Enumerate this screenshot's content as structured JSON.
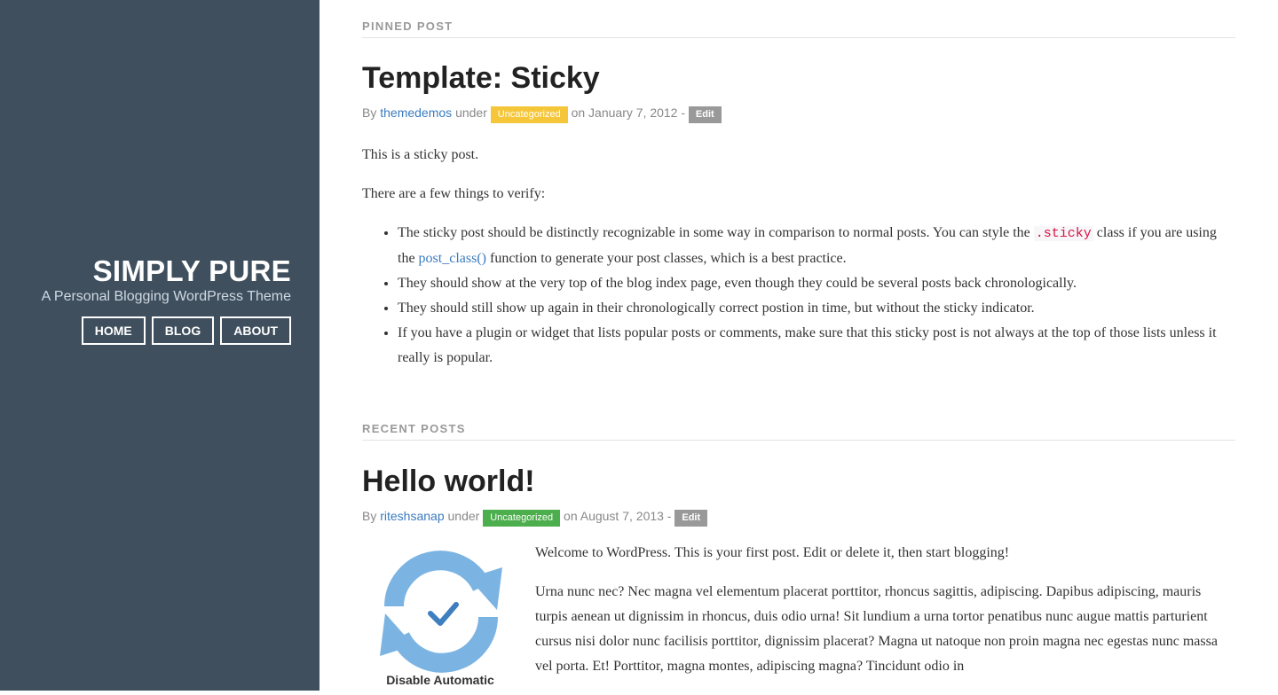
{
  "site": {
    "title": "SIMPLY PURE",
    "description": "A Personal Blogging WordPress Theme"
  },
  "nav": {
    "items": [
      {
        "label": "HOME"
      },
      {
        "label": "BLOG"
      },
      {
        "label": "ABOUT"
      }
    ]
  },
  "pinned": {
    "section_label": "PINNED POST",
    "title": "Template: Sticky",
    "meta": {
      "by": "By",
      "author": "themedemos",
      "under": "under",
      "category": "Uncategorized",
      "on": "on January 7, 2012 -",
      "edit": "Edit"
    },
    "p1": "This is a sticky post.",
    "p2": "There are a few things to verify:",
    "list": {
      "item1_a": "The sticky post should be distinctly recognizable in some way in comparison to normal posts. You can style the ",
      "item1_code": ".sticky",
      "item1_b": " class if you are using the ",
      "item1_link": "post_class()",
      "item1_c": " function to generate your post classes, which is a best practice.",
      "item2": "They should show at the very top of the blog index page, even though they could be several posts back chronologically.",
      "item3": "They should still show up again in their chronologically correct postion in time, but without the sticky indicator.",
      "item4": "If you have a plugin or widget that lists popular posts or comments, make sure that this sticky post is not always at the top of those lists unless it really is popular."
    }
  },
  "recent": {
    "section_label": "RECENT POSTS",
    "title": "Hello world!",
    "meta": {
      "by": "By",
      "author": "riteshsanap",
      "under": "under",
      "category": "Uncategorized",
      "on": "on August 7, 2013 -",
      "edit": "Edit"
    },
    "thumb_caption": "Disable Automatic",
    "p1": "Welcome to WordPress. This is your first post. Edit or delete it, then start blogging!",
    "p2": "Urna nunc nec? Nec magna vel elementum placerat porttitor, rhoncus sagittis, adipiscing. Dapibus adipiscing, mauris turpis aenean ut dignissim in rhoncus, duis odio urna! Sit lundium a urna tortor penatibus nunc augue mattis parturient cursus nisi dolor nunc facilisis porttitor, dignissim placerat? Magna ut natoque non proin magna nec egestas nunc massa vel porta. Et! Porttitor, magna montes, adipiscing magna? Tincidunt odio in"
  },
  "colors": {
    "sidebar_bg": "#3f4f5e",
    "link": "#3a7bc0",
    "badge_yellow": "#f5c63a",
    "badge_green": "#4cae4c",
    "badge_grey": "#999999",
    "code_red": "#dd1144"
  }
}
